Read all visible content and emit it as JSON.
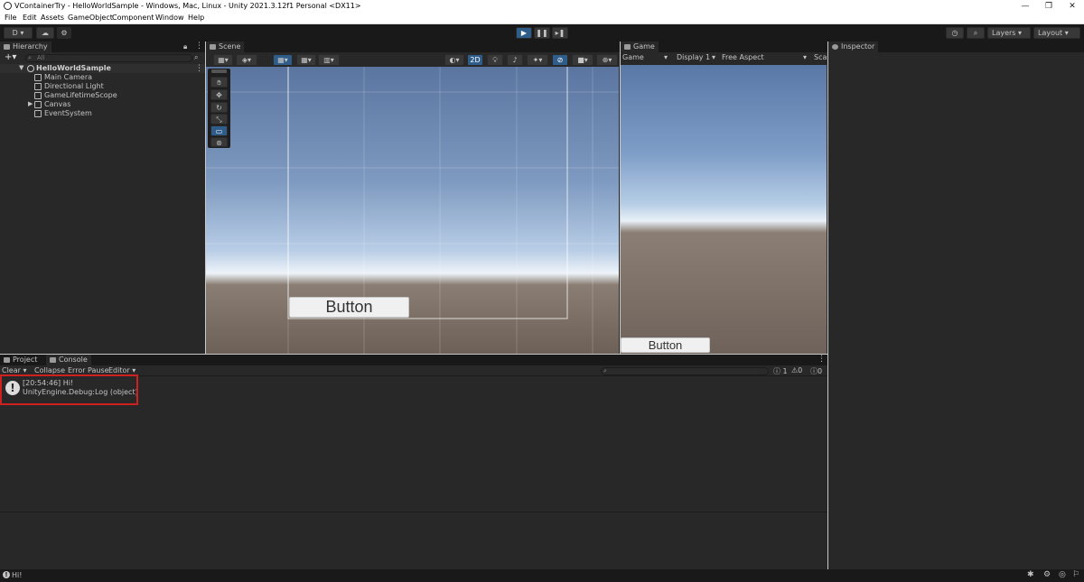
{
  "window": {
    "title": "VContainerTry - HelloWorldSample - Windows, Mac, Linux - Unity 2021.3.12f1 Personal <DX11>",
    "controls": [
      "—",
      "❐",
      "✕"
    ]
  },
  "menubar": [
    "File",
    "Edit",
    "Assets",
    "GameObject",
    "Component",
    "Window",
    "Help"
  ],
  "toolbar": {
    "account_label": "D ▾",
    "layers_label": "Layers",
    "layout_label": "Layout"
  },
  "hierarchy": {
    "tab_label": "Hierarchy",
    "search_placeholder": "All",
    "scene_name": "HelloWorldSample",
    "items": [
      {
        "label": "Main Camera"
      },
      {
        "label": "Directional Light"
      },
      {
        "label": "GameLifetimeScope"
      },
      {
        "label": "Canvas"
      },
      {
        "label": "EventSystem"
      }
    ]
  },
  "scene": {
    "tab_label": "Scene",
    "toggle_2d": "2D",
    "button_label": "Button"
  },
  "game": {
    "tab_label": "Game",
    "mode_select": "Game",
    "display_select": "Display 1",
    "aspect_select": "Free Aspect",
    "scale_label": "Sca",
    "button_label": "Button"
  },
  "inspector": {
    "tab_label": "Inspector"
  },
  "bottom": {
    "tabs": [
      "Project",
      "Console"
    ],
    "console_toolbar": {
      "clear": "Clear",
      "collapse": "Collapse",
      "error_pause": "Error Pause",
      "editor": "Editor"
    },
    "counts": {
      "log": "1",
      "warning": "0",
      "error": "0"
    },
    "log_entries": [
      {
        "time_message": "[20:54:46] Hi!",
        "detail": "UnityEngine.Debug:Log (object)"
      }
    ]
  },
  "statusbar": {
    "message": "Hi!"
  },
  "colors": {
    "highlight": "#d01f1f",
    "play_active": "#2f5d8a"
  }
}
